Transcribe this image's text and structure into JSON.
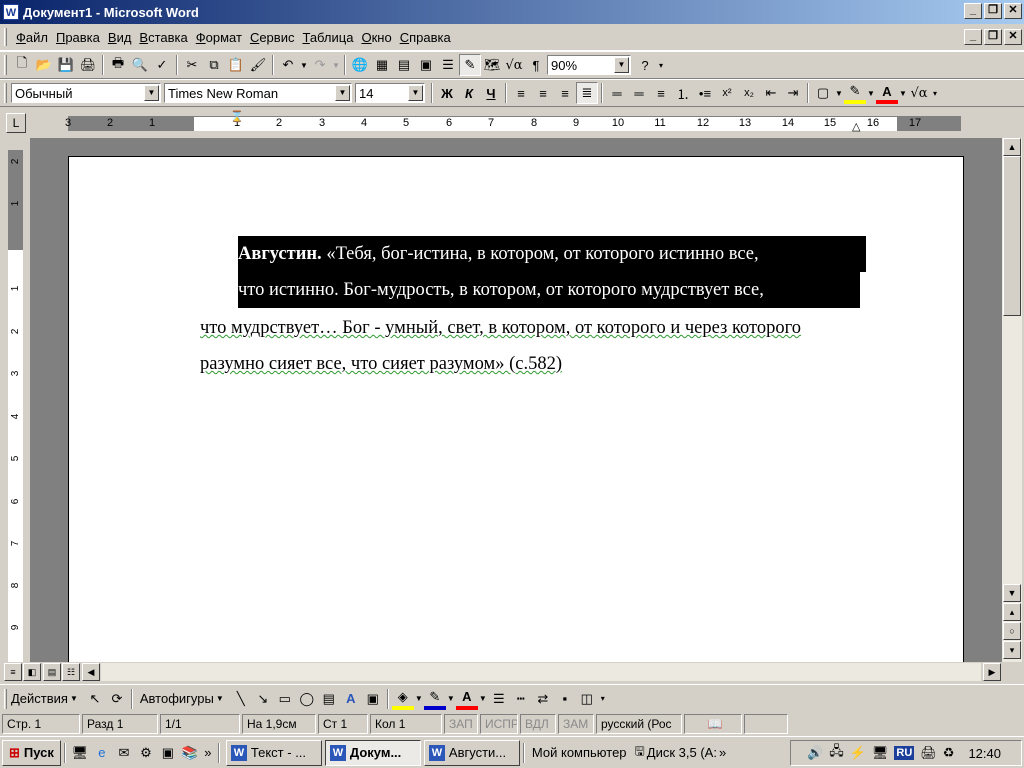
{
  "window": {
    "title": "Документ1 - Microsoft Word"
  },
  "menu": [
    "Файл",
    "Правка",
    "Вид",
    "Вставка",
    "Формат",
    "Сервис",
    "Таблица",
    "Окно",
    "Справка"
  ],
  "standard_toolbar": {
    "zoom": "90%"
  },
  "format_toolbar": {
    "style": "Обычный",
    "font": "Times New Roman",
    "size": "14"
  },
  "ruler": {
    "numbers": [
      "3",
      "2",
      "1",
      "1",
      "2",
      "3",
      "4",
      "5",
      "6",
      "7",
      "8",
      "9",
      "10",
      "11",
      "12",
      "13",
      "14",
      "15",
      "16",
      "17"
    ]
  },
  "vruler": {
    "numbers": [
      "2",
      "1",
      "1",
      "2",
      "3",
      "4",
      "5",
      "6",
      "7",
      "8",
      "9"
    ]
  },
  "document": {
    "line1_bold": "Августин.",
    "line1_rest": " «Тебя,  бог-истина,  в  котором,  от  которого  истинно  все,",
    "line2": "что истинно. Бог-мудрость, в котором, от которого мудрствует все,",
    "line3": "что мудрствует… Бог - умный, свет, в котором, от которого и через которого",
    "line4": "разумно сияет все, что сияет разумом» (с.582)"
  },
  "draw_toolbar": {
    "actions": "Действия",
    "autoshapes": "Автофигуры"
  },
  "status": {
    "page": "Стр.  1",
    "section": "Разд  1",
    "pages": "1/1",
    "at": "На  1,9см",
    "line": "Ст  1",
    "col": "Кол  1",
    "rec": "ЗАП",
    "trk": "ИСПР",
    "ext": "ВДЛ",
    "ovr": "ЗАМ",
    "lang": "русский (Рос"
  },
  "taskbar": {
    "start": "Пуск",
    "tasks": [
      "Текст - ...",
      "Докум...",
      "Августи..."
    ],
    "my_computer": "Мой компьютер",
    "disk": "Диск 3,5 (А:",
    "lang": "RU",
    "time": "12:40"
  }
}
